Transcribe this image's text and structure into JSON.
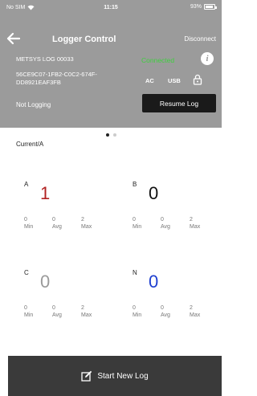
{
  "status_bar": {
    "carrier": "No SIM",
    "time": "11:15",
    "battery": "93%",
    "battery_level": 0.93
  },
  "header": {
    "title": "Logger Control",
    "disconnect_label": "Disconnect",
    "device_name": "METSYS LOG 00033",
    "connection_status": "Connected",
    "guid_line1": "56CE9C07-1FB2-C0C2-674F-",
    "guid_line2": "DD8921EAF3FB",
    "power_ac": "AC",
    "power_usb": "USB",
    "logging_status": "Not Logging",
    "resume_label": "Resume Log"
  },
  "pager": {
    "pages": 2,
    "current": 1
  },
  "section_label": "Current/A",
  "phases": [
    {
      "letter": "A",
      "value": "1",
      "color": "#b22222",
      "min": "0",
      "avg": "0",
      "max": "2",
      "min_label": "Min",
      "avg_label": "Avg",
      "max_label": "Max"
    },
    {
      "letter": "B",
      "value": "0",
      "color": "#111111",
      "min": "0",
      "avg": "0",
      "max": "2",
      "min_label": "Min",
      "avg_label": "Avg",
      "max_label": "Max"
    },
    {
      "letter": "C",
      "value": "0",
      "color": "#9a9a9a",
      "min": "0",
      "avg": "0",
      "max": "2",
      "min_label": "Min",
      "avg_label": "Avg",
      "max_label": "Max"
    },
    {
      "letter": "N",
      "value": "0",
      "color": "#1e3fd0",
      "min": "0",
      "avg": "0",
      "max": "2",
      "min_label": "Min",
      "avg_label": "Avg",
      "max_label": "Max"
    }
  ],
  "footer": {
    "start_label": "Start New Log",
    "icon": "edit-icon"
  },
  "colors": {
    "header_bg": "#9b9b9b",
    "connected": "#3fcf3f",
    "button_dark": "#1a1a1a",
    "footer_bg": "#3a3a3a"
  }
}
